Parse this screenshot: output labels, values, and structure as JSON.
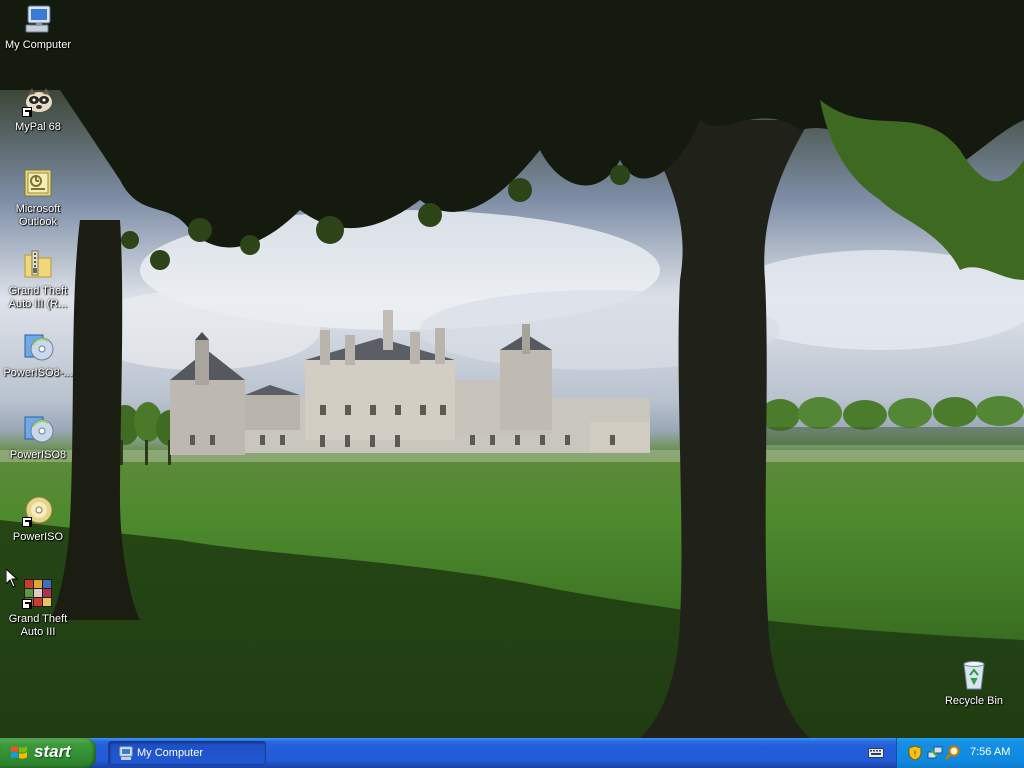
{
  "desktop": {
    "icons": [
      {
        "label": "My Computer",
        "icon": "my-computer-icon"
      },
      {
        "label": "MyPal 68",
        "icon": "mypal-icon",
        "shortcut": true
      },
      {
        "label": "Microsoft Outlook",
        "icon": "outlook-icon"
      },
      {
        "label": "Grand Theft Auto III (R...",
        "icon": "zip-folder-icon"
      },
      {
        "label": "PowerISO8-...",
        "icon": "poweriso-installer-icon"
      },
      {
        "label": "PowerISO8",
        "icon": "poweriso-installer-icon"
      },
      {
        "label": "PowerISO",
        "icon": "poweriso-disc-icon",
        "shortcut": true
      },
      {
        "label": "Grand Theft Auto III",
        "icon": "gta3-icon",
        "shortcut": true
      },
      {
        "label": "Recycle Bin",
        "icon": "recycle-bin-icon"
      }
    ]
  },
  "taskbar": {
    "start_label": "start",
    "tasks": [
      {
        "label": "My Computer",
        "icon": "my-computer-icon",
        "active": true
      }
    ],
    "tray": {
      "icons": [
        "security-shield-icon",
        "network-icon",
        "search-icon"
      ],
      "clock": "7:56 AM"
    },
    "language_bar_icon": "keyboard-icon"
  },
  "colors": {
    "taskbar_blue": "#245edb",
    "start_green": "#3c9a3c",
    "tray_blue": "#0f88df"
  }
}
